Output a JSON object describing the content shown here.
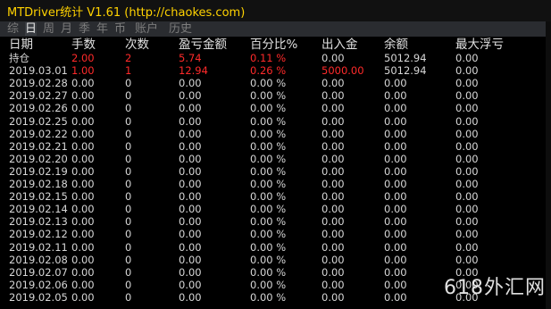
{
  "window": {
    "title": "MTDriver统计 V1.61 (http://chaokes.com)"
  },
  "tabs": [
    {
      "label": "综",
      "active": false
    },
    {
      "label": "日",
      "active": true
    },
    {
      "label": "周",
      "active": false
    },
    {
      "label": "月",
      "active": false
    },
    {
      "label": "季",
      "active": false
    },
    {
      "label": "年",
      "active": false
    },
    {
      "label": "币",
      "active": false
    },
    {
      "label": "账户",
      "active": false
    },
    {
      "label": "历史",
      "active": false
    }
  ],
  "table": {
    "headers": [
      "日期",
      "手数",
      "次数",
      "盈亏金额",
      "百分比%",
      "出入金",
      "余额",
      "最大浮亏"
    ],
    "rows": [
      {
        "cells": [
          "持仓",
          "2.00",
          "2",
          "5.74",
          "0.11 %",
          "0.00",
          "5012.94",
          "0.00"
        ],
        "red": [
          1,
          2,
          3,
          4
        ]
      },
      {
        "cells": [
          "2019.03.01",
          "1.00",
          "1",
          "12.94",
          "0.26 %",
          "5000.00",
          "5012.94",
          "0.00"
        ],
        "red": [
          1,
          2,
          3,
          4,
          5
        ]
      },
      {
        "cells": [
          "2019.02.28",
          "0.00",
          "0",
          "0.00",
          "0.00 %",
          "0.00",
          "0.00",
          "0.00"
        ],
        "red": []
      },
      {
        "cells": [
          "2019.02.27",
          "0.00",
          "0",
          "0.00",
          "0.00 %",
          "0.00",
          "0.00",
          "0.00"
        ],
        "red": []
      },
      {
        "cells": [
          "2019.02.26",
          "0.00",
          "0",
          "0.00",
          "0.00 %",
          "0.00",
          "0.00",
          "0.00"
        ],
        "red": []
      },
      {
        "cells": [
          "2019.02.25",
          "0.00",
          "0",
          "0.00",
          "0.00 %",
          "0.00",
          "0.00",
          "0.00"
        ],
        "red": []
      },
      {
        "cells": [
          "2019.02.22",
          "0.00",
          "0",
          "0.00",
          "0.00 %",
          "0.00",
          "0.00",
          "0.00"
        ],
        "red": []
      },
      {
        "cells": [
          "2019.02.21",
          "0.00",
          "0",
          "0.00",
          "0.00 %",
          "0.00",
          "0.00",
          "0.00"
        ],
        "red": []
      },
      {
        "cells": [
          "2019.02.20",
          "0.00",
          "0",
          "0.00",
          "0.00 %",
          "0.00",
          "0.00",
          "0.00"
        ],
        "red": []
      },
      {
        "cells": [
          "2019.02.19",
          "0.00",
          "0",
          "0.00",
          "0.00 %",
          "0.00",
          "0.00",
          "0.00"
        ],
        "red": []
      },
      {
        "cells": [
          "2019.02.18",
          "0.00",
          "0",
          "0.00",
          "0.00 %",
          "0.00",
          "0.00",
          "0.00"
        ],
        "red": []
      },
      {
        "cells": [
          "2019.02.15",
          "0.00",
          "0",
          "0.00",
          "0.00 %",
          "0.00",
          "0.00",
          "0.00"
        ],
        "red": []
      },
      {
        "cells": [
          "2019.02.14",
          "0.00",
          "0",
          "0.00",
          "0.00 %",
          "0.00",
          "0.00",
          "0.00"
        ],
        "red": []
      },
      {
        "cells": [
          "2019.02.13",
          "0.00",
          "0",
          "0.00",
          "0.00 %",
          "0.00",
          "0.00",
          "0.00"
        ],
        "red": []
      },
      {
        "cells": [
          "2019.02.12",
          "0.00",
          "0",
          "0.00",
          "0.00 %",
          "0.00",
          "0.00",
          "0.00"
        ],
        "red": []
      },
      {
        "cells": [
          "2019.02.11",
          "0.00",
          "0",
          "0.00",
          "0.00 %",
          "0.00",
          "0.00",
          "0.00"
        ],
        "red": []
      },
      {
        "cells": [
          "2019.02.08",
          "0.00",
          "0",
          "0.00",
          "0.00 %",
          "0.00",
          "0.00",
          "0.00"
        ],
        "red": []
      },
      {
        "cells": [
          "2019.02.07",
          "0.00",
          "0",
          "0.00",
          "0.00 %",
          "0.00",
          "0.00",
          "0.00"
        ],
        "red": []
      },
      {
        "cells": [
          "2019.02.06",
          "0.00",
          "0",
          "0.00",
          "0.00 %",
          "0.00",
          "0.00",
          "0.00"
        ],
        "red": []
      },
      {
        "cells": [
          "2019.02.05",
          "0.00",
          "0",
          "0.00",
          "0.00 %",
          "0.00",
          "0.00",
          "0.00"
        ],
        "red": []
      }
    ]
  },
  "watermark": "618外汇网",
  "colors": {
    "background": "#000000",
    "title": "#ffd200",
    "text": "#d6d6d6",
    "highlight": "#ff2a2a",
    "tab_active": "#e8e8e8",
    "tab_inactive": "#7c7c7c"
  }
}
